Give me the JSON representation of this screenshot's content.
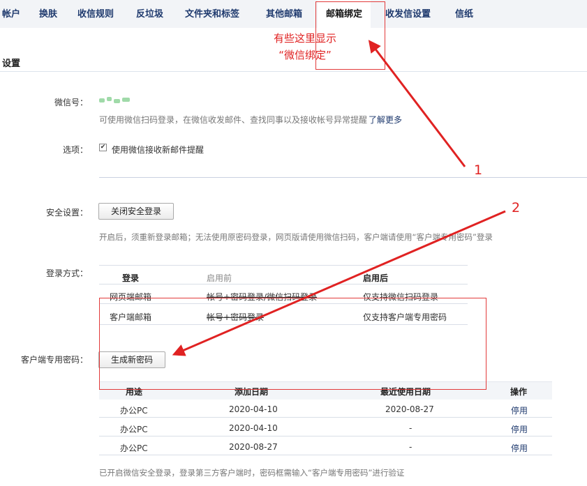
{
  "nav": {
    "tabs": [
      "帐户",
      "换肤",
      "收信规则",
      "反垃圾",
      "文件夹和标签",
      "其他邮箱",
      "邮箱绑定",
      "收发信设置",
      "信纸"
    ],
    "active_index": 6
  },
  "section_title": "设置",
  "wechat": {
    "label": "微信号：",
    "desc": "可使用微信扫码登录，在微信收发邮件、查找同事以及接收帐号异常提醒",
    "learn_more": "了解更多"
  },
  "options": {
    "label": "选项：",
    "checkbox_label": "使用微信接收新邮件提醒",
    "checked": true
  },
  "security": {
    "label": "安全设置：",
    "button": "关闭安全登录",
    "desc": "开启后，须重新登录邮箱；无法使用原密码登录，网页版请使用微信扫码，客户端请使用“客户端专用密码”登录"
  },
  "login_method": {
    "label": "登录方式：",
    "headers": [
      "登录",
      "启用前",
      "启用后"
    ],
    "rows": [
      {
        "name": "网页端邮箱",
        "before": "帐号+密码登录/微信扫码登录",
        "after": "仅支持微信扫码登录"
      },
      {
        "name": "客户端邮箱",
        "before": "帐号+密码登录",
        "after": "仅支持客户端专用密码"
      }
    ]
  },
  "client_password": {
    "label": "客户端专用密码：",
    "button": "生成新密码",
    "headers": [
      "用途",
      "添加日期",
      "最近使用日期",
      "操作"
    ],
    "rows": [
      {
        "usage": "办公PC",
        "added": "2020-04-10",
        "last_used": "2020-08-27",
        "action": "停用"
      },
      {
        "usage": "办公PC",
        "added": "2020-04-10",
        "last_used": "-",
        "action": "停用"
      },
      {
        "usage": "办公PC",
        "added": "2020-08-27",
        "last_used": "-",
        "action": "停用"
      }
    ],
    "note": "已开启微信安全登录，登录第三方客户端时，密码框需输入“客户端专用密码”进行验证"
  },
  "annotations": {
    "text_line1": "有些这里显示",
    "text_line2": "“微信绑定”",
    "num1": "1",
    "num2": "2",
    "color": "#e02222"
  }
}
